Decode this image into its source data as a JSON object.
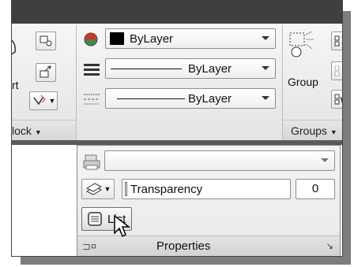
{
  "ribbon": {
    "block_panel": {
      "partial_label": "rt",
      "footer_label": "lock"
    },
    "properties_panel": {
      "color_value": "ByLayer",
      "color_swatch": "#000000",
      "linetype_value": "ByLayer",
      "lineweight_value": "ByLayer"
    },
    "groups_panel": {
      "group_label": "Group",
      "footer_label": "Groups"
    }
  },
  "flyout": {
    "plot_style_value": "",
    "transparency_label": "Transparency",
    "transparency_value": "0",
    "list_label": "List",
    "footer_label": "Properties"
  },
  "colors": {
    "title_bar": "#3f3f3f",
    "ribbon_bg": "#eeeeee",
    "accent_red": "#c0392b",
    "accent_green": "#2e8b3a"
  },
  "icons": [
    "insert-block-icon",
    "create-block-icon",
    "edit-block-icon",
    "define-attributes-icon",
    "color-wheel-icon",
    "linetype-icon",
    "lineweight-icon",
    "group-icon",
    "ungroup-icon",
    "group-edit-icon",
    "group-select-icon",
    "plot-style-icon",
    "layers-icon",
    "list-icon",
    "pin-icon",
    "dialog-launcher-icon",
    "mouse-cursor-icon"
  ]
}
